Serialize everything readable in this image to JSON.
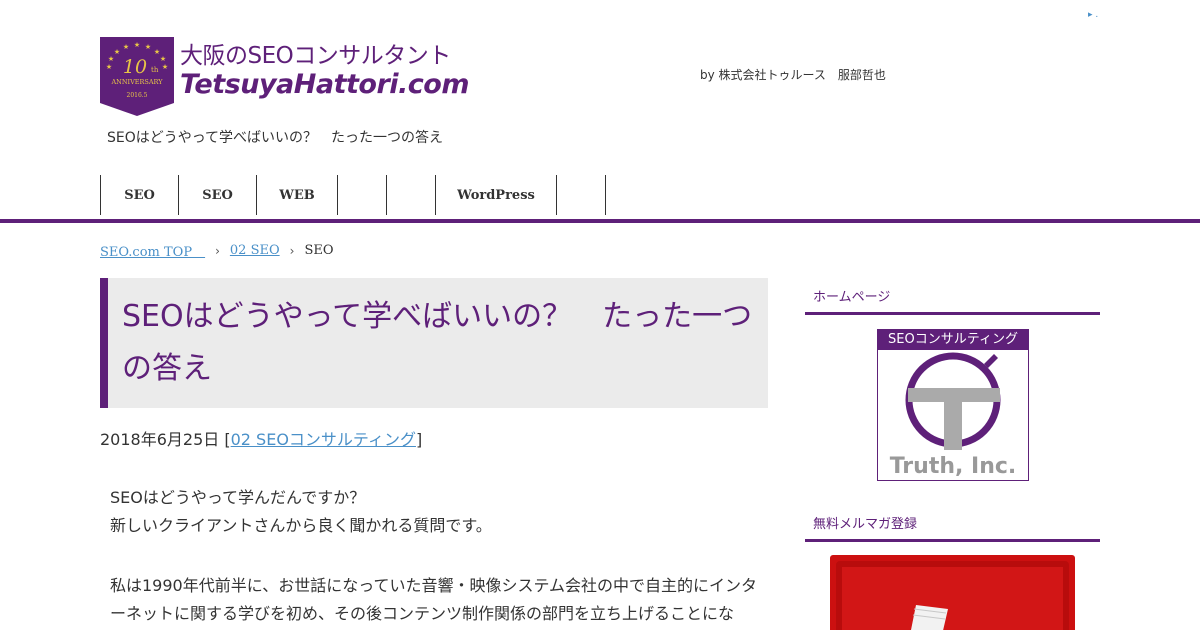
{
  "ad_marker": "▸ .",
  "logo": {
    "badge_number": "10",
    "badge_suffix": "th",
    "badge_word": "ANNIVERSARY",
    "badge_date": "2016.5",
    "line1": "大阪のSEOコンサルタント",
    "line2": "TetsuyaHattori.com"
  },
  "byline": "by 株式会社トゥルース　服部哲也",
  "tagline": "SEOはどうやって学べばいいの？　たった一つの答え",
  "nav": [
    {
      "label": "SEO",
      "width": 78
    },
    {
      "label": "SEO",
      "width": 78
    },
    {
      "label": "WEB",
      "width": 81
    },
    {
      "label": "",
      "width": 49
    },
    {
      "label": "",
      "width": 49
    },
    {
      "label": "WordPress",
      "width": 121
    },
    {
      "label": "",
      "width": 49
    }
  ],
  "breadcrumb": {
    "home": "SEO.com TOP　 ",
    "category": "02 SEO",
    "current": "SEO"
  },
  "post": {
    "title": "SEOはどうやって学べばいいの？　たった一つの答え",
    "date": "2018年6月25日",
    "category_link": "02 SEOコンサルティング",
    "paragraphs": [
      [
        "SEOはどうやって学んだんですか？",
        "新しいクライアントさんから良く聞かれる質問です。"
      ],
      [
        "私は1990年代前半に、お世話になっていた音響・映像システム会社の中で自主的にインターネットに関する学びを初め、その後コンテンツ制作関係の部門を立ち上げることにな"
      ]
    ]
  },
  "sidebar": {
    "widget1_title": "ホームページ",
    "banner_heading": "SEOコンサルティング",
    "banner_company": "Truth, Inc.",
    "widget2_title": "無料メルマガ登録"
  },
  "colors": {
    "brand_purple": "#5e2079",
    "link_blue": "#4a90c8",
    "title_bg": "#ebebeb",
    "banner_red": "#cc1010"
  }
}
